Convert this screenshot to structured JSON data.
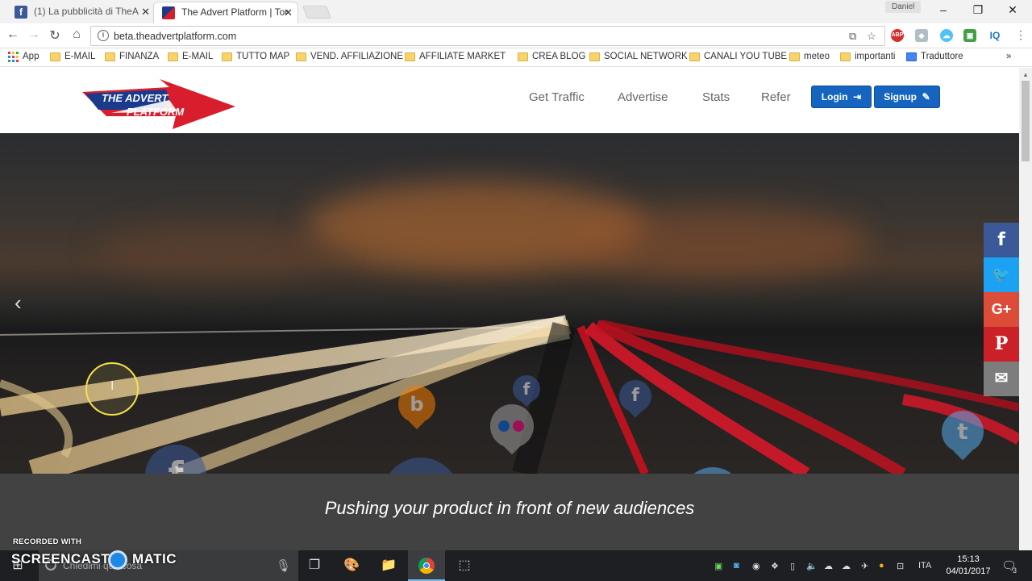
{
  "browser": {
    "profile_name": "Daniel",
    "tabs": [
      {
        "title": "(1) La pubblicità di TheA",
        "active": false
      },
      {
        "title": "The Advert Platform | Tor",
        "active": true
      }
    ],
    "url": "beta.theadvertplatform.com",
    "window_controls": {
      "minimize": "–",
      "maximize": "❐",
      "close": "✕"
    }
  },
  "bookmarks": [
    {
      "label": "App",
      "type": "apps"
    },
    {
      "label": "E-MAIL",
      "type": "folder"
    },
    {
      "label": "FINANZA",
      "type": "folder"
    },
    {
      "label": "E-MAIL",
      "type": "folder"
    },
    {
      "label": "TUTTO MAP",
      "type": "folder"
    },
    {
      "label": "VEND. AFFILIAZIONE",
      "type": "folder"
    },
    {
      "label": "AFFILIATE MARKETIN",
      "type": "folder"
    },
    {
      "label": "CREA BLOG",
      "type": "folder"
    },
    {
      "label": "SOCIAL NETWORK",
      "type": "folder"
    },
    {
      "label": "CANALI YOU TUBE",
      "type": "folder"
    },
    {
      "label": "meteo",
      "type": "folder"
    },
    {
      "label": "importanti",
      "type": "folder"
    },
    {
      "label": "Traduttore",
      "type": "translate"
    }
  ],
  "site": {
    "logo": {
      "line1": "THE ADVERT",
      "line2": "PLATFORM"
    },
    "nav": [
      "Get Traffic",
      "Advertise",
      "Stats",
      "Refer"
    ],
    "login_label": "Login",
    "signup_label": "Signup",
    "tagline": "Pushing your product in front of new audiences",
    "hero_bubbles": [
      "f",
      "f",
      "f",
      "f",
      "t",
      "t",
      "b",
      "flickr"
    ]
  },
  "share_bar": [
    {
      "name": "facebook",
      "glyph": "f",
      "color": "#3b5998"
    },
    {
      "name": "twitter",
      "glyph": "🐦",
      "color": "#1da1f2"
    },
    {
      "name": "google-plus",
      "glyph": "G+",
      "color": "#dd4b39"
    },
    {
      "name": "pinterest",
      "glyph": "P",
      "color": "#cb2027"
    },
    {
      "name": "email",
      "glyph": "✉",
      "color": "#7d7d7d"
    }
  ],
  "watermark": {
    "small": "RECORDED WITH",
    "big_left": "SCREENCAST",
    "big_right": "MATIC"
  },
  "taskbar": {
    "search_placeholder": "Chiedimi qualcosa",
    "language": "ITA",
    "time": "15:13",
    "date": "04/01/2017",
    "notification_count": "3"
  }
}
